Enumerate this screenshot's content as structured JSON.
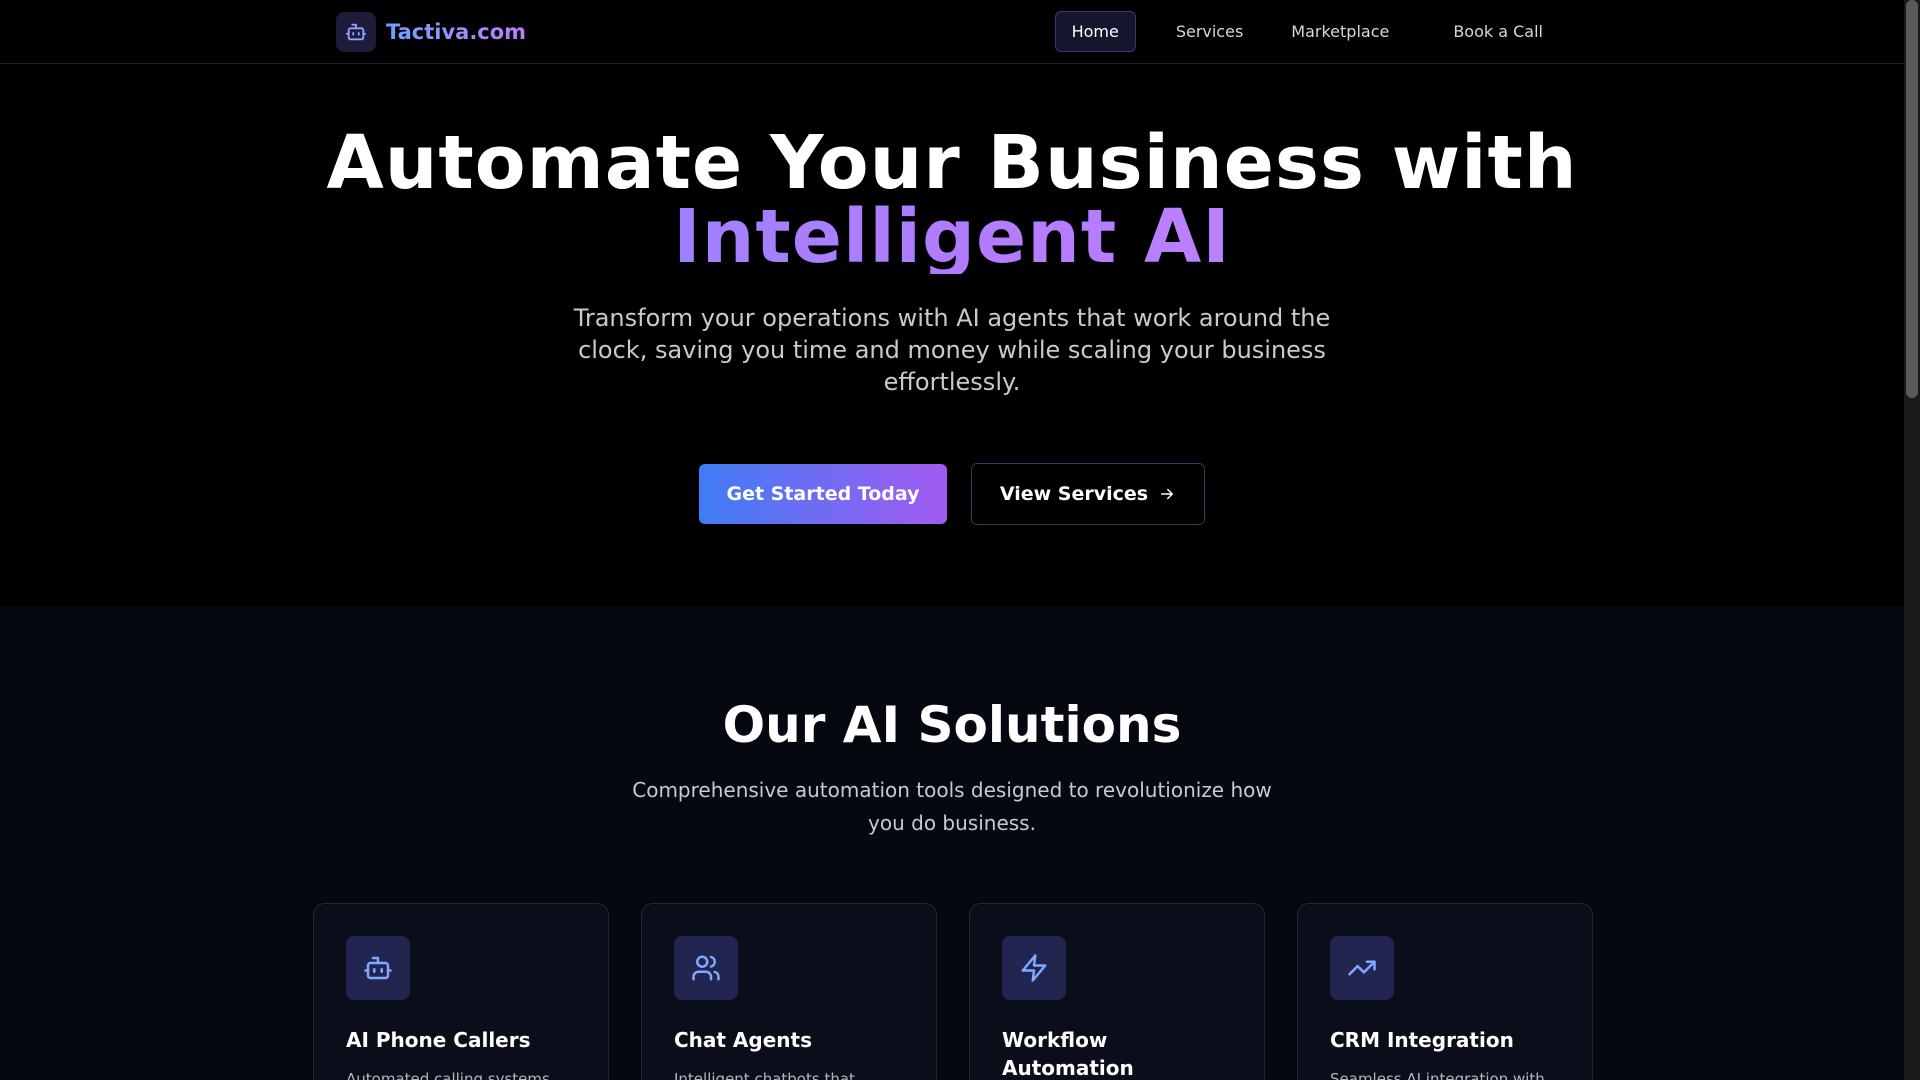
{
  "brand": {
    "name": "Tactiva.com",
    "accent": "#7c8cff",
    "accent_2": "#b07cff"
  },
  "nav": {
    "items": [
      {
        "label": "Home",
        "active": true
      },
      {
        "label": "Services"
      },
      {
        "label": "Marketplace"
      },
      {
        "label": "Book a Call"
      }
    ]
  },
  "hero": {
    "title_line1": "Automate Your Business with",
    "title_line2": "Intelligent AI",
    "subtitle": "Transform your operations with AI agents that work around the clock, saving you time and money while scaling your business effortlessly.",
    "primary_cta": "Get Started Today",
    "secondary_cta": "View Services",
    "secondary_icon": "arrow-right-icon"
  },
  "solutions": {
    "title": "Our AI Solutions",
    "subtitle": "Comprehensive automation tools designed to revolutionize how you do business.",
    "cards": [
      {
        "icon": "robot-icon",
        "title": "AI Phone Callers",
        "desc": "Automated calling systems"
      },
      {
        "icon": "users-icon",
        "title": "Chat Agents",
        "desc": "Intelligent chatbots that"
      },
      {
        "icon": "lightning-icon",
        "title": "Workflow Automation",
        "desc": ""
      },
      {
        "icon": "trending-up-icon",
        "title": "CRM Integration",
        "desc": "Seamless AI integration with"
      }
    ]
  }
}
